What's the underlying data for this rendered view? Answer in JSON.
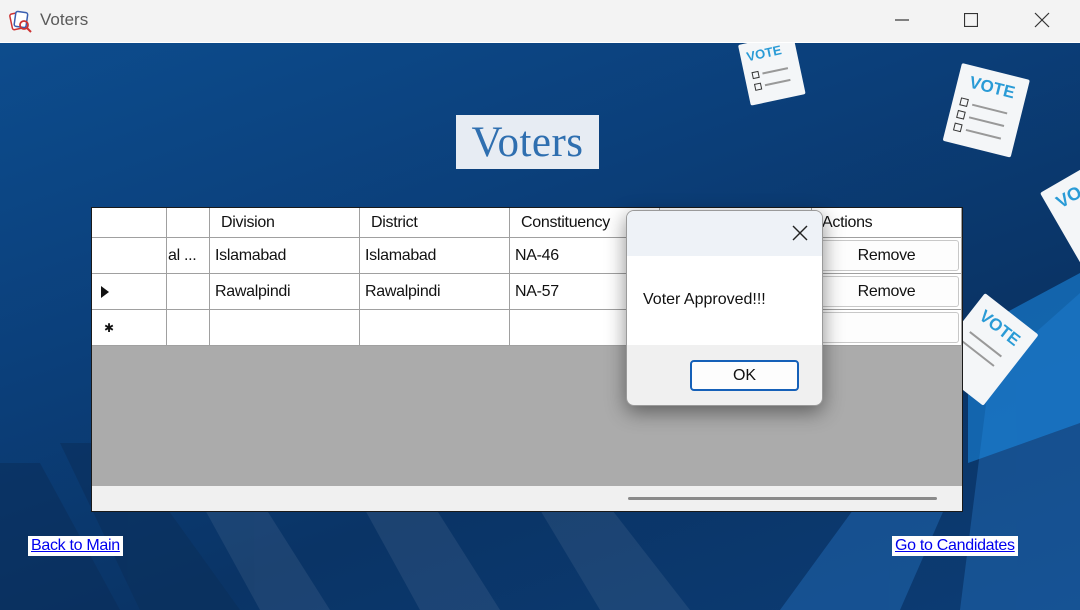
{
  "window": {
    "title": "Voters",
    "icon": "ballot-icon"
  },
  "page": {
    "heading": "Voters"
  },
  "grid": {
    "columns": [
      "",
      "Division",
      "District",
      "Constituency",
      "Actions"
    ],
    "rows": [
      {
        "indicator": "",
        "col0": "al ...",
        "division": "Islamabad",
        "district": "Islamabad",
        "constituency": "NA-46",
        "action": "Remove"
      },
      {
        "indicator": "current-row-arrow",
        "col0": "",
        "division": "Rawalpindi",
        "district": "Rawalpindi",
        "constituency": "NA-57",
        "action": "Remove"
      },
      {
        "indicator": "new-row-star",
        "col0": "",
        "division": "",
        "district": "",
        "constituency": "",
        "action": ""
      }
    ]
  },
  "links": {
    "back": "Back to Main",
    "candidates": "Go to Candidates"
  },
  "dialog": {
    "message": "Voter Approved!!!",
    "ok": "OK"
  },
  "decor": {
    "vote_paper_text": [
      "VOTE",
      "VOTE",
      "VOTE",
      "VO"
    ]
  },
  "colors": {
    "background": "#0b3f7a",
    "heading": "#2f6fb0",
    "link": "#0000ee",
    "ok_border": "#1560b8"
  }
}
